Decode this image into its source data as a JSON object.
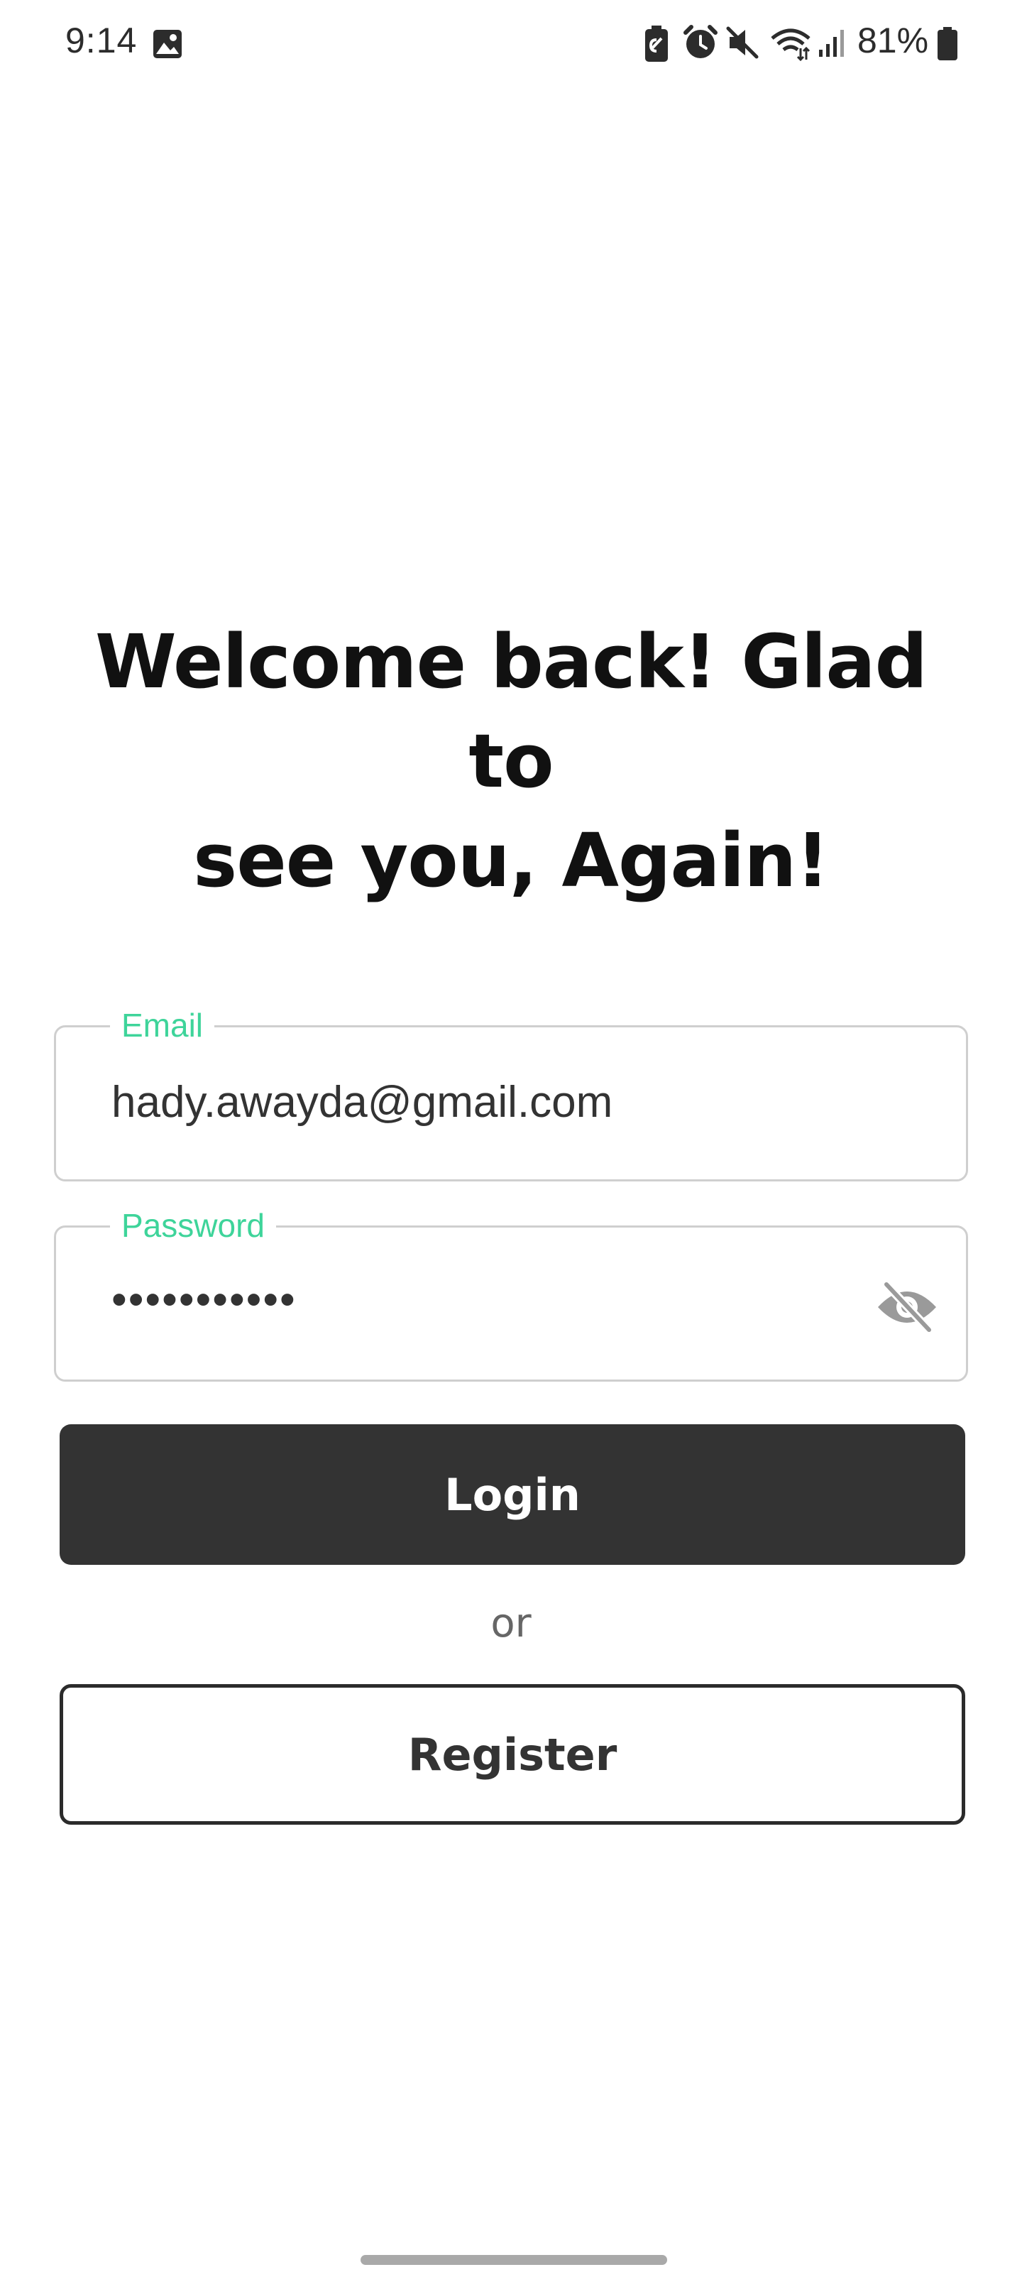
{
  "status_bar": {
    "time": "9:14",
    "battery_percent": "81%",
    "icons": [
      "gallery-icon",
      "battery-saver-icon",
      "alarm-icon",
      "mute-icon",
      "wifi-icon",
      "signal-icon",
      "battery-icon"
    ]
  },
  "heading": {
    "line1": "Welcome back! Glad to",
    "line2": "see you, Again!"
  },
  "email_field": {
    "label": "Email",
    "value": "hady.awayda@gmail.com"
  },
  "password_field": {
    "label": "Password",
    "masked_value": "•••••••••••",
    "toggle_icon": "eye-off-icon"
  },
  "buttons": {
    "login_label": "Login",
    "or_text": "or",
    "register_label": "Register"
  },
  "colors": {
    "accent": "#3ed49a",
    "primary_button": "#333333",
    "text_dark": "#111111",
    "field_border": "#cfcfcf"
  }
}
